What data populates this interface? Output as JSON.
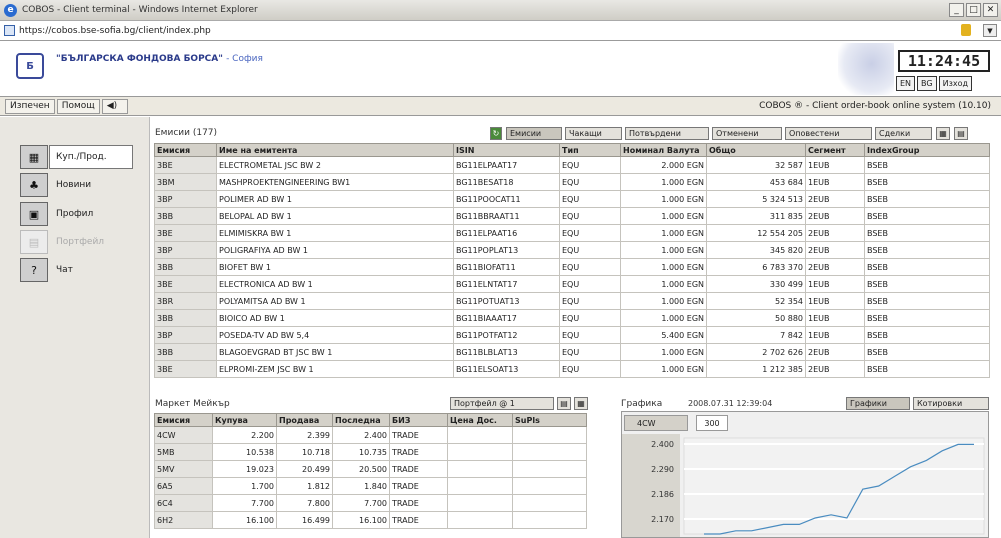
{
  "browser": {
    "title": "COBOS - Client terminal - Windows Internet Explorer",
    "url": "https://cobos.bse-sofia.bg/client/index.php"
  },
  "header": {
    "brand_name": "\"БЪЛГАРСКА ФОНДОВА БОРСА\"",
    "brand_city": "- София",
    "clock": "11:24:45",
    "buttons": [
      "EN",
      "BG",
      "Изход"
    ]
  },
  "menu": {
    "items": [
      "Изпечен",
      "Помощ"
    ],
    "system_label": "COBOS ® - Client order-book online system",
    "version": "(10.10)"
  },
  "nav": [
    {
      "label": "Куп./Прод.",
      "icon": "buy-sell-icon",
      "active": true
    },
    {
      "label": "Новини",
      "icon": "news-icon"
    },
    {
      "label": "Профил",
      "icon": "profile-icon"
    },
    {
      "label": "Портфейл",
      "icon": "portfolio-icon",
      "disabled": true
    },
    {
      "label": "Чат",
      "icon": "chat-icon"
    }
  ],
  "issues": {
    "title": "Емисии (177)",
    "tabs": [
      "Емисии",
      "Чакащи",
      "Потвърдени",
      "Отменени",
      "Оповестени",
      "Сделки"
    ],
    "columns": [
      "Емисия",
      "Име на емитента",
      "ISIN",
      "Тип",
      "Номинал Валута",
      "Общо",
      "Сегмент",
      "IndexGroup"
    ],
    "rows": [
      [
        "3ВЕ",
        "ELECTROMETAL JSC   BW 2",
        "BG11ELPAAT17",
        "EQU",
        "2.000 EGN",
        "32 587",
        "1EUB",
        "BSEB"
      ],
      [
        "3BM",
        "MASHPROEKTENGINEERING BW1",
        "BG11BESAT18",
        "EQU",
        "1.000 EGN",
        "453 684",
        "1EUB",
        "BSEB"
      ],
      [
        "3BP",
        "POLIMER AD    BW 1",
        "BG11POOCAT11",
        "EQU",
        "1.000 EGN",
        "5 324 513",
        "2EUB",
        "BSEB"
      ],
      [
        "3BB",
        "BELOPAL AD    BW 1",
        "BG11BBRAAT11",
        "EQU",
        "1.000 EGN",
        "311 835",
        "2EUB",
        "BSEB"
      ],
      [
        "3BE",
        "ELMIMISKRA    BW 1",
        "BG11ELPAAT16",
        "EQU",
        "1.000 EGN",
        "12 554 205",
        "2EUB",
        "BSEB"
      ],
      [
        "3BP",
        "POLIGRAFIYA AD   BW 1",
        "BG11POPLAT13",
        "EQU",
        "1.000 EGN",
        "345 820",
        "2EUB",
        "BSEB"
      ],
      [
        "3BB",
        "BIOFET          BW 1",
        "BG11BIOFAT11",
        "EQU",
        "1.000 EGN",
        "6 783 370",
        "2EUB",
        "BSEB"
      ],
      [
        "3BE",
        "ELECTRONICA AD   BW 1",
        "BG11ELNTAT17",
        "EQU",
        "1.000 EGN",
        "330 499",
        "1EUB",
        "BSEB"
      ],
      [
        "3BR",
        "POLYAMITSA AD    BW 1",
        "BG11POTUAT13",
        "EQU",
        "1.000 EGN",
        "52 354",
        "1EUB",
        "BSEB"
      ],
      [
        "3BB",
        "BIOICO AD      BW 1",
        "BG11BIAAAT17",
        "EQU",
        "1.000 EGN",
        "50 880",
        "1EUB",
        "BSEB"
      ],
      [
        "3BP",
        "POSEDA-TV AD    BW 5,4",
        "BG11POTFAT12",
        "EQU",
        "5.400 EGN",
        "7 842",
        "1EUB",
        "BSEB"
      ],
      [
        "3BB",
        "BLAGOEVGRAD BT JSC  BW 1",
        "BG11BLBLAT13",
        "EQU",
        "1.000 EGN",
        "2 702 626",
        "2EUB",
        "BSEB"
      ],
      [
        "3BE",
        "ELPROMI-ZEM JSC   BW 1",
        "BG11ELSOAT13",
        "EQU",
        "1.000 EGN",
        "1 212 385",
        "2EUB",
        "BSEB"
      ]
    ]
  },
  "market_maker": {
    "title": "Маркет Мейкър",
    "portfolio_btn": "Портфейл @ 1",
    "columns": [
      "Емисия",
      "Купува",
      "Продава",
      "Последна",
      "БИЗ",
      "Цена Дос.",
      "SuPls"
    ],
    "rows": [
      [
        "4CW",
        "2.200",
        "2.399",
        "2.400",
        "TRADE",
        "",
        ""
      ],
      [
        "5MB",
        "10.538",
        "10.718",
        "10.735",
        "TRADE",
        "",
        ""
      ],
      [
        "5MV",
        "19.023",
        "20.499",
        "20.500",
        "TRADE",
        "",
        ""
      ],
      [
        "6A5",
        "1.700",
        "1.812",
        "1.840",
        "TRADE",
        "",
        ""
      ],
      [
        "6C4",
        "7.700",
        "7.800",
        "7.700",
        "TRADE",
        "",
        ""
      ],
      [
        "6H2",
        "16.100",
        "16.499",
        "16.100",
        "TRADE",
        "",
        ""
      ]
    ]
  },
  "chart_panel": {
    "label": "Графика",
    "timestamp": "2008.07.31  12:39:04",
    "tabs": [
      "Графики",
      "Котировки"
    ],
    "symbol": "4CW",
    "subtab": "300"
  },
  "chart_data": {
    "type": "line",
    "title": "",
    "xlabel": "",
    "ylabel": "",
    "yticks": [
      "2.400",
      "2.290",
      "2.186",
      "2.170"
    ],
    "ylim": [
      2.12,
      2.42
    ],
    "series": [
      {
        "values": [
          2.12,
          2.12,
          2.13,
          2.13,
          2.14,
          2.15,
          2.15,
          2.17,
          2.18,
          2.17,
          2.26,
          2.27,
          2.3,
          2.33,
          2.35,
          2.38,
          2.4,
          2.4
        ]
      }
    ],
    "grid": true
  }
}
